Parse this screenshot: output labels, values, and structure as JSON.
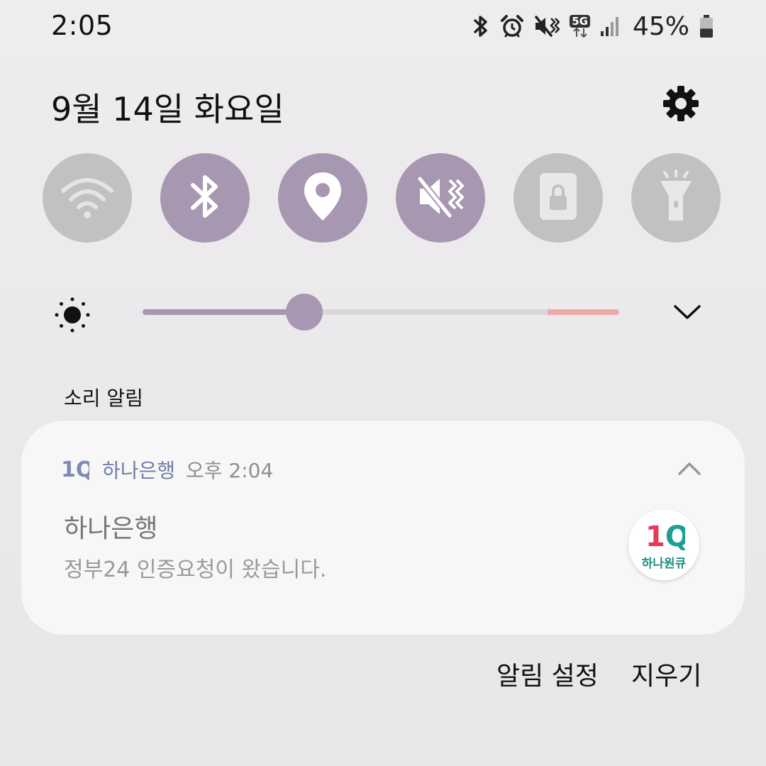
{
  "status_bar": {
    "time": "2:05",
    "network_badge": "5G",
    "battery_percent": "45%",
    "battery_level": 0.45,
    "icons": [
      "bluetooth-icon",
      "alarm-icon",
      "vibrate-icon",
      "5g-icon",
      "signal-icon",
      "battery-icon"
    ]
  },
  "header": {
    "date": "9월 14일 화요일",
    "settings_icon": "gear-icon"
  },
  "quick_settings": {
    "toggles": [
      {
        "name": "wifi",
        "icon": "wifi-icon",
        "active": false
      },
      {
        "name": "bluetooth",
        "icon": "bluetooth-icon",
        "active": true
      },
      {
        "name": "location",
        "icon": "location-pin-icon",
        "active": true
      },
      {
        "name": "vibrate",
        "icon": "vibrate-icon",
        "active": true
      },
      {
        "name": "screen-lock",
        "icon": "screen-lock-icon",
        "active": false
      },
      {
        "name": "flashlight",
        "icon": "flashlight-icon",
        "active": false
      }
    ],
    "brightness": {
      "level": 0.34,
      "high_brightness_zone_start": 0.85
    }
  },
  "notifications": {
    "section_label": "소리 알림",
    "items": [
      {
        "app_name": "하나은행",
        "time": "오후 2:04",
        "app_logo_text": "1Q",
        "title": "하나은행",
        "body": "정부24 인증요청이 왔습니다.",
        "large_icon_text": "1Q",
        "large_icon_label": "하나원큐"
      }
    ],
    "actions": {
      "settings_label": "알림 설정",
      "clear_label": "지우기"
    }
  },
  "colors": {
    "accent": "#a797b0",
    "toggle_off": "#c2c0c2",
    "warning_zone": "#efaaa5",
    "app_name": "#6d7fa6",
    "brand_red": "#e63a57",
    "brand_teal": "#1fa08f"
  }
}
